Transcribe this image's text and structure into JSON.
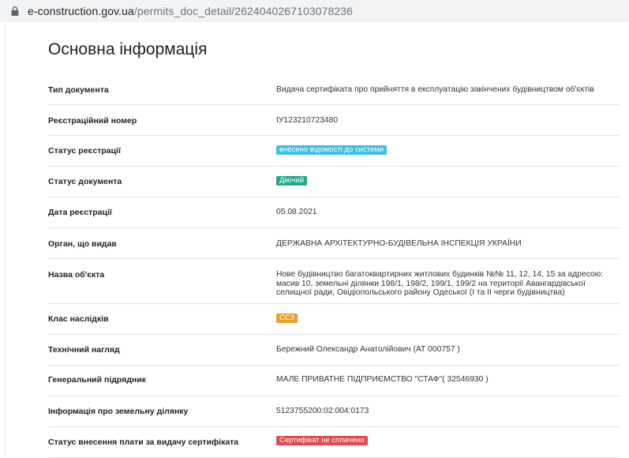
{
  "browser": {
    "url_host": "e-construction.gov.ua",
    "url_path": "/permits_doc_detail/2624040267103078236"
  },
  "page": {
    "title": "Основна інформація"
  },
  "rows": [
    {
      "label": "Тип документа",
      "value": "Видача сертифіката про прийняття в експлуатацію закінчених будівництвом об'єктів"
    },
    {
      "label": "Реєстраційний номер",
      "value": "ІУ123210723480"
    },
    {
      "label": "Статус реєстрації",
      "badge": "внесено відомості до системи",
      "badge_color": "#3dbfe0"
    },
    {
      "label": "Статус документа",
      "badge": "Діючий",
      "badge_color": "#22a98a"
    },
    {
      "label": "Дата реєстрації",
      "value": "05.08.2021"
    },
    {
      "label": "Орган, що видав",
      "value": "ДЕРЖАВНА АРХІТЕКТУРНО-БУДІВЕЛЬНА ІНСПЕКЦІЯ УКРАЇНИ"
    },
    {
      "label": "Назва об'єкта",
      "value": "Нове будівництво багатоквартирних житлових будинків №№ 11, 12, 14, 15 за адресою: масив 10, земельні ділянки 198/1, 198/2, 199/1, 199/2 на території Авангардівської селищної ради, Овідіопольського району Одеської (І та ІІ черги будівництва)"
    },
    {
      "label": "Клас наслідків",
      "badge": "СС3",
      "badge_color": "#eba126"
    },
    {
      "label": "Технічний нагляд",
      "value": "Бережний Олександр Анатолійович (АТ 000757 )"
    },
    {
      "label": "Генеральний підрядник",
      "value": "МАЛЕ ПРИВАТНЕ ПІДПРИЄМСТВО \"СТАФ\"( 32546930 )"
    },
    {
      "label": "Інформація про земельну ділянку",
      "value": "5123755200:02:004:0173"
    },
    {
      "label": "Статус внесення плати за видачу сертифіката",
      "badge": "Сертифікат не сплачено",
      "badge_color": "#e5484d"
    }
  ]
}
